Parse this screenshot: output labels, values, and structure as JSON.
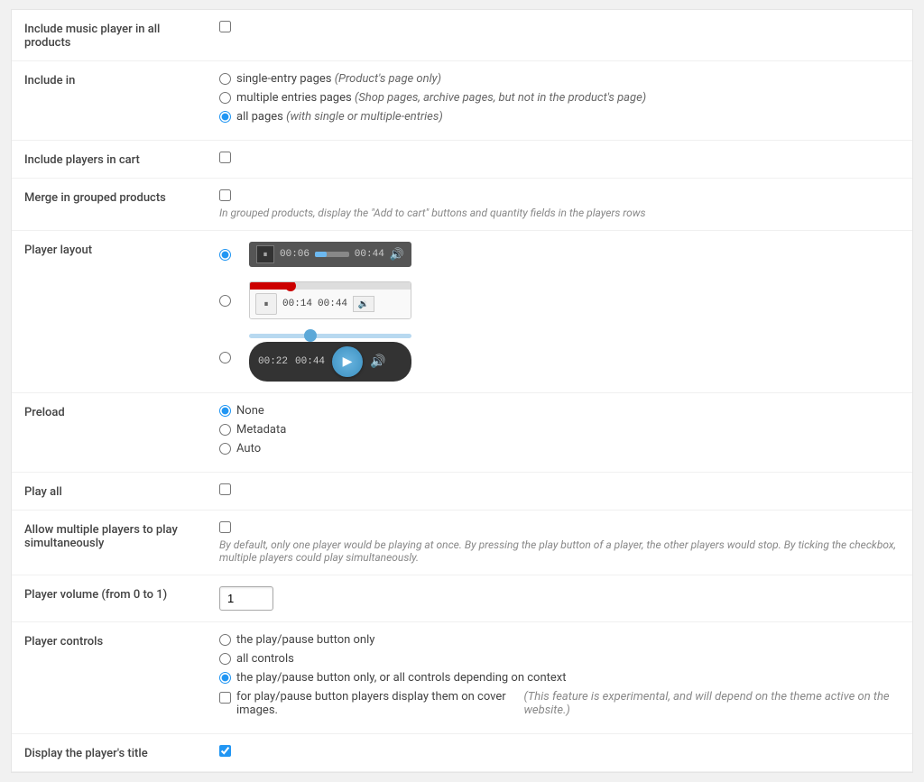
{
  "rows": [
    {
      "id": "include-music-player",
      "label": "Include music player in all products",
      "type": "checkbox",
      "checked": false
    },
    {
      "id": "include-in",
      "label": "Include in",
      "type": "radio-group",
      "options": [
        {
          "id": "single-entry",
          "label": "single-entry pages",
          "italic": "(Product's page only)",
          "checked": false
        },
        {
          "id": "multiple-entries",
          "label": "multiple entries pages",
          "italic": "(Shop pages, archive pages, but not in the product's page)",
          "checked": false
        },
        {
          "id": "all-pages",
          "label": "all pages",
          "italic": "(with single or multiple-entries)",
          "checked": true
        }
      ]
    },
    {
      "id": "include-players-cart",
      "label": "Include players in cart",
      "type": "checkbox",
      "checked": false
    },
    {
      "id": "merge-grouped",
      "label": "Merge in grouped products",
      "type": "checkbox-with-hint",
      "checked": false,
      "hint": "In grouped products, display the \"Add to cart\" buttons and quantity fields in the players rows"
    },
    {
      "id": "player-layout",
      "label": "Player layout",
      "type": "player-layout"
    },
    {
      "id": "preload",
      "label": "Preload",
      "type": "radio-group",
      "options": [
        {
          "id": "none",
          "label": "None",
          "checked": true
        },
        {
          "id": "metadata",
          "label": "Metadata",
          "checked": false
        },
        {
          "id": "auto",
          "label": "Auto",
          "checked": false
        }
      ]
    },
    {
      "id": "play-all",
      "label": "Play all",
      "type": "checkbox",
      "checked": false
    },
    {
      "id": "allow-multiple",
      "label": "Allow multiple players to play simultaneously",
      "type": "checkbox-with-hint",
      "checked": false,
      "hint": "By default, only one player would be playing at once. By pressing the play button of a player, the other players would stop. By ticking the checkbox, multiple players could play simultaneously."
    },
    {
      "id": "player-volume",
      "label": "Player volume (from 0 to 1)",
      "type": "text-input",
      "value": "1"
    },
    {
      "id": "player-controls",
      "label": "Player controls",
      "type": "radio-group-with-checkbox",
      "options": [
        {
          "id": "play-pause-only",
          "label": "the play/pause button only",
          "checked": false
        },
        {
          "id": "all-controls",
          "label": "all controls",
          "checked": false
        },
        {
          "id": "play-pause-context",
          "label": "the play/pause button only, or all controls depending on context",
          "checked": true
        }
      ],
      "extra_checkbox": {
        "id": "cover-images",
        "label": "for play/pause button players display them on cover images.",
        "italic": "(This feature is experimental, and will depend on the theme active on the website.)",
        "checked": false
      }
    },
    {
      "id": "display-title",
      "label": "Display the player's title",
      "type": "checkbox",
      "checked": true
    }
  ],
  "players": [
    {
      "id": "player1",
      "selected": true,
      "time_elapsed": "00:06",
      "time_total": "00:44"
    },
    {
      "id": "player2",
      "selected": false,
      "time_elapsed": "00:14",
      "time_total": "00:44"
    },
    {
      "id": "player3",
      "selected": false,
      "time_elapsed": "00:22",
      "time_total": "00:44"
    }
  ]
}
